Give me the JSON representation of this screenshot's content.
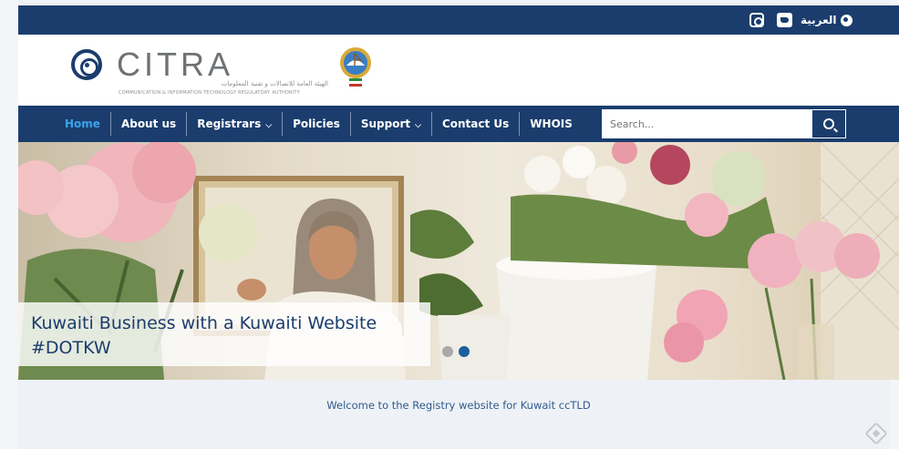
{
  "topbar": {
    "language_label": "العربية",
    "icons": [
      "instagram-icon",
      "twitter-icon",
      "globe-icon"
    ],
    "bg_color": "#1b3d6e"
  },
  "header": {
    "logo_text": "CITRA",
    "logo_subtitle_ar": "الهيئة العامة للاتصالات و تقنية المعلومات",
    "logo_subtitle_en": "COMMUNICATION & INFORMATION TECHNOLOGY REGULATORY AUTHORITY"
  },
  "nav": {
    "items": [
      {
        "label": "Home",
        "active": true,
        "dropdown": false
      },
      {
        "label": "About us",
        "active": false,
        "dropdown": false
      },
      {
        "label": "Registrars",
        "active": false,
        "dropdown": true
      },
      {
        "label": "Policies",
        "active": false,
        "dropdown": false
      },
      {
        "label": "Support",
        "active": false,
        "dropdown": true
      },
      {
        "label": "Contact Us",
        "active": false,
        "dropdown": false
      },
      {
        "label": "WHOIS",
        "active": false,
        "dropdown": false
      }
    ],
    "search_placeholder": "Search...",
    "active_color": "#3aa4e8"
  },
  "hero": {
    "caption_line1": "Kuwaiti Business with a Kuwaiti Website",
    "caption_line2": "#DOTKW",
    "slides_total": 2,
    "active_slide": 2
  },
  "main": {
    "welcome_text": "Welcome to the Registry website for Kuwait ccTLD"
  }
}
